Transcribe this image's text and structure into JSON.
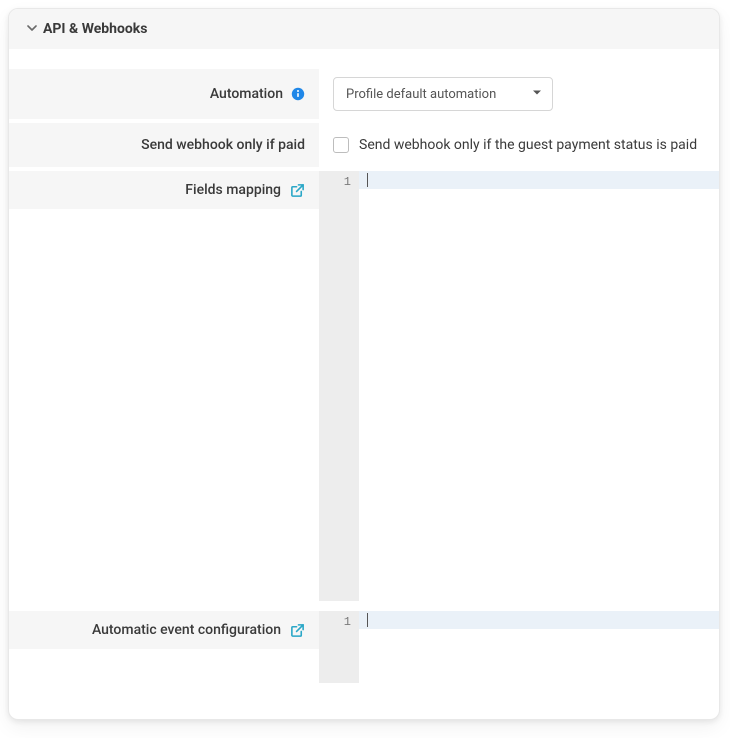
{
  "section": {
    "title": "API & Webhooks"
  },
  "automation": {
    "label": "Automation",
    "selected": "Profile default automation"
  },
  "webhook_paid": {
    "label": "Send webhook only if paid",
    "checkbox_label": "Send webhook only if the guest payment status is paid",
    "checked": false
  },
  "fields_mapping": {
    "label": "Fields mapping",
    "editor": {
      "line_number": "1",
      "content": ""
    }
  },
  "auto_event_config": {
    "label": "Automatic event configuration",
    "editor": {
      "line_number": "1",
      "content": ""
    }
  },
  "colors": {
    "info_blue": "#1f87e8",
    "link_teal": "#2aa7c7"
  }
}
